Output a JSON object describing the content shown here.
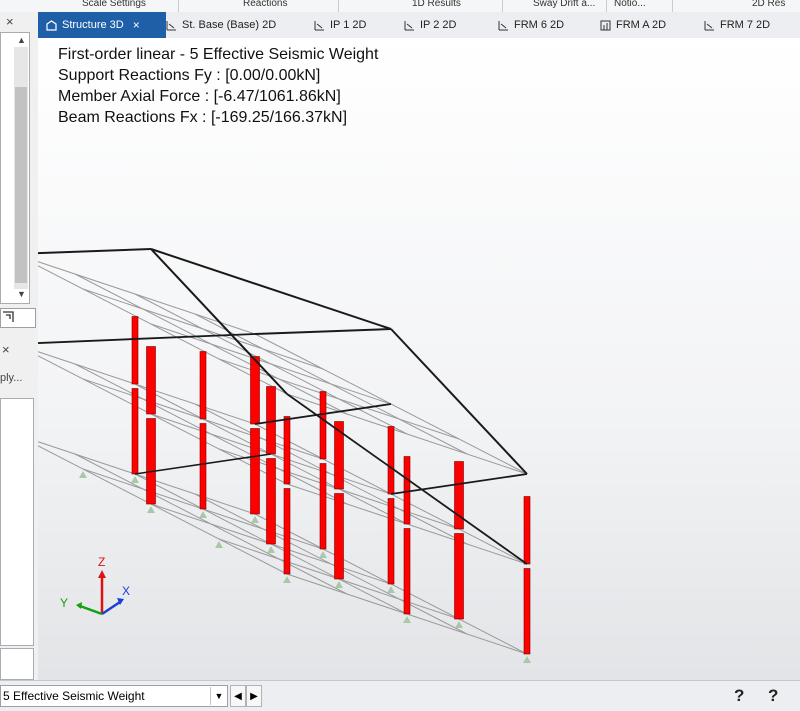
{
  "ribbon": {
    "groups": [
      "Scale Settings",
      "Reactions",
      "1D Results",
      "Sway Drift a...",
      "Notio...",
      "2D Res"
    ]
  },
  "tabs": [
    {
      "label": "Structure 3D",
      "icon": "3d-structure-icon",
      "active": true,
      "closable": true
    },
    {
      "label": "St. Base (Base) 2D",
      "icon": "2d-view-icon",
      "active": false,
      "closable": false
    },
    {
      "label": "IP 1 2D",
      "icon": "2d-view-icon",
      "active": false,
      "closable": false
    },
    {
      "label": "IP 2 2D",
      "icon": "2d-view-icon",
      "active": false,
      "closable": false
    },
    {
      "label": "FRM 6 2D",
      "icon": "2d-view-icon",
      "active": false,
      "closable": false
    },
    {
      "label": "FRM A 2D",
      "icon": "frame-view-icon",
      "active": false,
      "closable": false
    },
    {
      "label": "FRM 7 2D",
      "icon": "2d-view-icon",
      "active": false,
      "closable": false
    }
  ],
  "left_panel": {
    "top_pin": "×",
    "lower_pin": "×",
    "lower_text": "ply..."
  },
  "viewport": {
    "info_lines": [
      "First-order linear - 5 Effective Seismic Weight",
      "Support Reactions Fy : [0.00/0.00kN]",
      "Member Axial Force : [-6.47/1061.86kN]",
      "Beam Reactions Fx : [-169.25/166.37kN]"
    ],
    "axis_labels": {
      "z": "Z",
      "x": "X",
      "y": "Y"
    },
    "colors": {
      "force_diagram": "#ff0000",
      "frame_member": "#1a1a1a",
      "grid": "#9a9a9a",
      "support": "#a8c8a8"
    }
  },
  "status": {
    "loadcase": "5 Effective Seismic Weight",
    "prev_label": "◀",
    "next_label": "▶",
    "help1": "?",
    "help2": "?"
  }
}
